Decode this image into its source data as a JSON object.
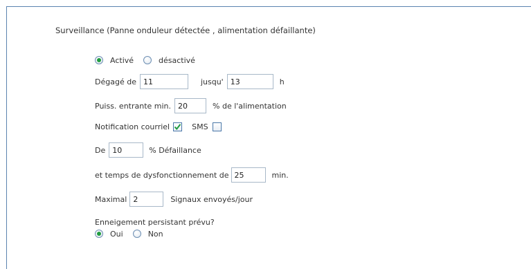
{
  "title": "Surveillance (Panne onduleur détectée , alimentation défaillante)",
  "mode": {
    "active_label": "Activé",
    "inactive_label": "désactivé",
    "selected": "active"
  },
  "time_range": {
    "from_label": "Dégagé de",
    "from_value": "11",
    "to_label": "jusqu'",
    "to_value": "13",
    "unit": "h"
  },
  "input_power": {
    "label": "Puiss. entrante min.",
    "value": "20",
    "suffix": "% de l'alimentation"
  },
  "notification": {
    "email_label": "Notification courriel",
    "email_checked": true,
    "sms_label": "SMS",
    "sms_checked": false
  },
  "failure": {
    "prefix": "De",
    "value": "10",
    "suffix": "% Défaillance"
  },
  "downtime": {
    "label": "et temps de dysfonctionnement de",
    "value": "25",
    "unit": "min."
  },
  "max_signals": {
    "label": "Maximal",
    "value": "2",
    "suffix": "Signaux envoyés/jour"
  },
  "snow": {
    "question": "Enneigement persistant prévu?",
    "yes_label": "Oui",
    "no_label": "Non",
    "selected": "yes"
  },
  "colors": {
    "accent": "#1f9c3f",
    "border": "#5b84b0"
  }
}
